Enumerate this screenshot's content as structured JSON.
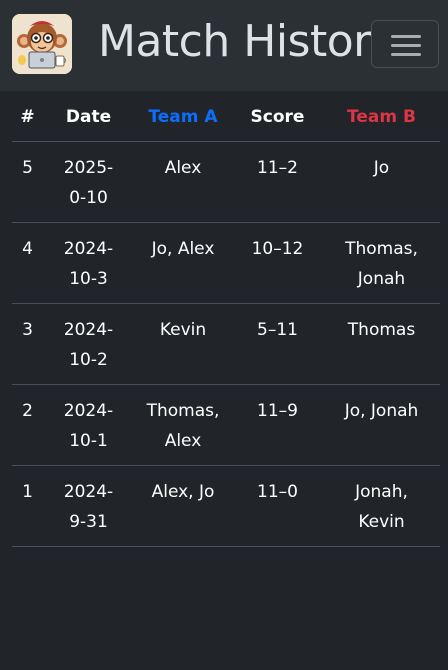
{
  "navbar": {
    "title": "Match History",
    "logo_icon": "monkey-laptop-logo-icon",
    "menu_icon": "hamburger-menu-icon"
  },
  "colors": {
    "background": "#212529",
    "navbar": "#2b3035",
    "team_a": "#0d6efd",
    "team_b": "#dc3545"
  },
  "table": {
    "headers": {
      "number": "#",
      "date": "Date",
      "team_a": "Team A",
      "score": "Score",
      "team_b": "Team B"
    },
    "rows": [
      {
        "number": "5",
        "date_l1": "2025-",
        "date_l2": "0-10",
        "team_a_l1": "Alex",
        "team_a_l2": "",
        "score": "11–2",
        "team_b_l1": "Jo",
        "team_b_l2": ""
      },
      {
        "number": "4",
        "date_l1": "2024-",
        "date_l2": "10-3",
        "team_a_l1": "Jo, Alex",
        "team_a_l2": "",
        "score": "10–12",
        "team_b_l1": "Thomas,",
        "team_b_l2": "Jonah"
      },
      {
        "number": "3",
        "date_l1": "2024-",
        "date_l2": "10-2",
        "team_a_l1": "Kevin",
        "team_a_l2": "",
        "score": "5–11",
        "team_b_l1": "Thomas",
        "team_b_l2": ""
      },
      {
        "number": "2",
        "date_l1": "2024-",
        "date_l2": "10-1",
        "team_a_l1": "Thomas,",
        "team_a_l2": "Alex",
        "score": "11–9",
        "team_b_l1": "Jo, Jonah",
        "team_b_l2": ""
      },
      {
        "number": "1",
        "date_l1": "2024-",
        "date_l2": "9-31",
        "team_a_l1": "Alex, Jo",
        "team_a_l2": "",
        "score": "11–0",
        "team_b_l1": "Jonah,",
        "team_b_l2": "Kevin"
      }
    ]
  }
}
